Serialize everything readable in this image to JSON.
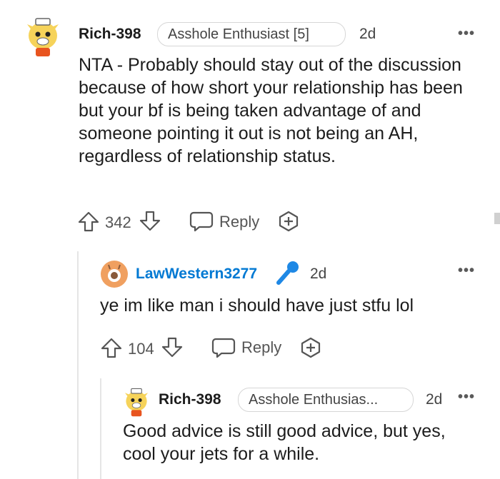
{
  "comments": [
    {
      "username": "Rich-398",
      "flair": "Asshole Enthusiast [5]",
      "time": "2d",
      "body": "NTA - Probably should stay out of the discussion because of how short your relationship has been but your bf is being taken advantage of and someone pointing it out is not being an AH, regardless of relationship status.",
      "votes": "342",
      "reply_label": "Reply",
      "more": "•••"
    },
    {
      "username": "LawWestern3277",
      "time": "2d",
      "body": "ye im like man i should have just stfu lol",
      "votes": "104",
      "reply_label": "Reply",
      "more": "•••"
    },
    {
      "username": "Rich-398",
      "flair": "Asshole Enthusias...",
      "time": "2d",
      "body": "Good advice is still good advice, but yes, cool your jets for a while.",
      "more": "•••"
    }
  ],
  "colors": {
    "op_username": "#0079d3",
    "mic_icon": "#1e88e5",
    "avatar_orange": "#f0a060"
  },
  "icons": [
    "upvote-icon",
    "downvote-icon",
    "reply-bubble-icon",
    "award-plus-icon",
    "overflow-dots-icon",
    "microphone-icon"
  ]
}
